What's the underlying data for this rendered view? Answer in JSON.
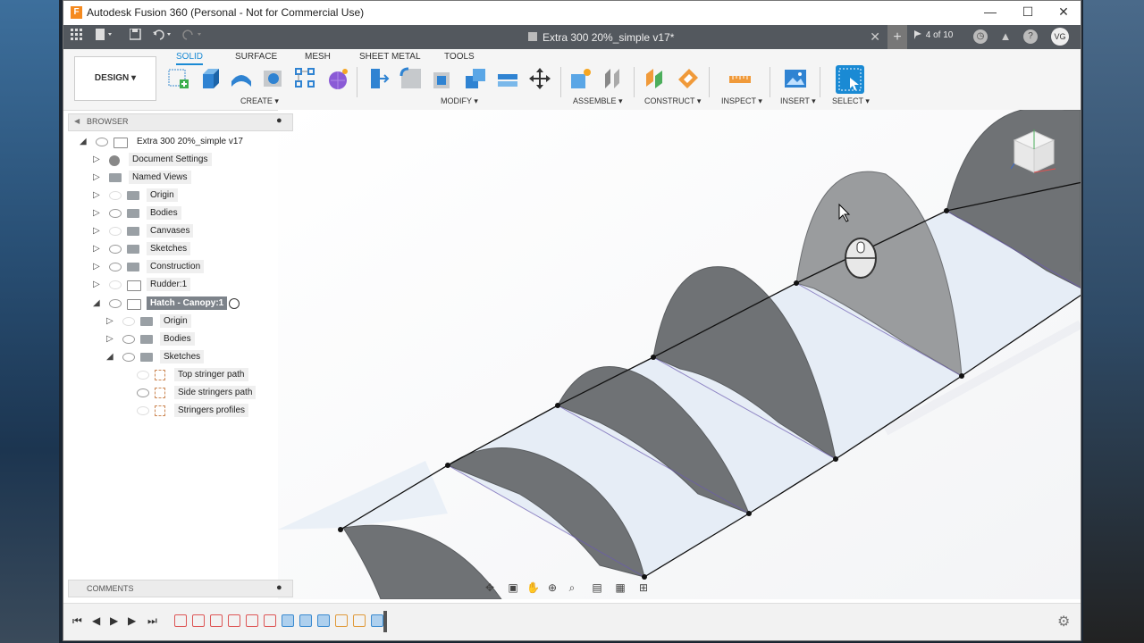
{
  "window": {
    "title": "Autodesk Fusion 360 (Personal - Not for Commercial Use)",
    "controls": [
      "—",
      "☐",
      "✕"
    ]
  },
  "tabbar": {
    "document_name": "Extra 300 20%_simple v17*",
    "close": "✕",
    "new_tab": "+",
    "jobs": "4 of 10",
    "avatar": "VG"
  },
  "toolbar": {
    "design_label": "DESIGN ▾",
    "tabs": [
      "SOLID",
      "SURFACE",
      "MESH",
      "SHEET METAL",
      "TOOLS"
    ],
    "active_tab": "SOLID",
    "groups": {
      "create": "CREATE ▾",
      "modify": "MODIFY ▾",
      "assemble": "ASSEMBLE ▾",
      "construct": "CONSTRUCT ▾",
      "inspect": "INSPECT ▾",
      "insert": "INSERT ▾",
      "select": "SELECT ▾"
    }
  },
  "browser": {
    "header": "BROWSER",
    "items": [
      {
        "label": "Extra 300 20%_simple v17",
        "icon": "component-icon"
      },
      {
        "label": "Document Settings",
        "icon": "gear-icon"
      },
      {
        "label": "Named Views",
        "icon": "folder-icon"
      },
      {
        "label": "Origin",
        "icon": "folder-icon"
      },
      {
        "label": "Bodies",
        "icon": "folder-icon"
      },
      {
        "label": "Canvases",
        "icon": "folder-icon"
      },
      {
        "label": "Sketches",
        "icon": "folder-icon"
      },
      {
        "label": "Construction",
        "icon": "folder-icon"
      },
      {
        "label": "Rudder:1",
        "icon": "component-icon"
      },
      {
        "label": "Hatch - Canopy:1",
        "icon": "component-icon",
        "active": true
      },
      {
        "label": "Origin",
        "icon": "folder-icon"
      },
      {
        "label": "Bodies",
        "icon": "folder-icon"
      },
      {
        "label": "Sketches",
        "icon": "folder-icon"
      },
      {
        "label": "Top stringer path",
        "icon": "sketch-icon"
      },
      {
        "label": "Side stringers path",
        "icon": "sketch-icon"
      },
      {
        "label": "Stringers profiles",
        "icon": "sketch-icon"
      }
    ]
  },
  "comments": {
    "label": "COMMENTS"
  },
  "colors": {
    "accent": "#1a8ad4",
    "titlebar_bg": "#53585e",
    "former_gray": "#6f7275",
    "selected_former": "#9a9c9e",
    "skin_fill": "#dfe8f4"
  }
}
